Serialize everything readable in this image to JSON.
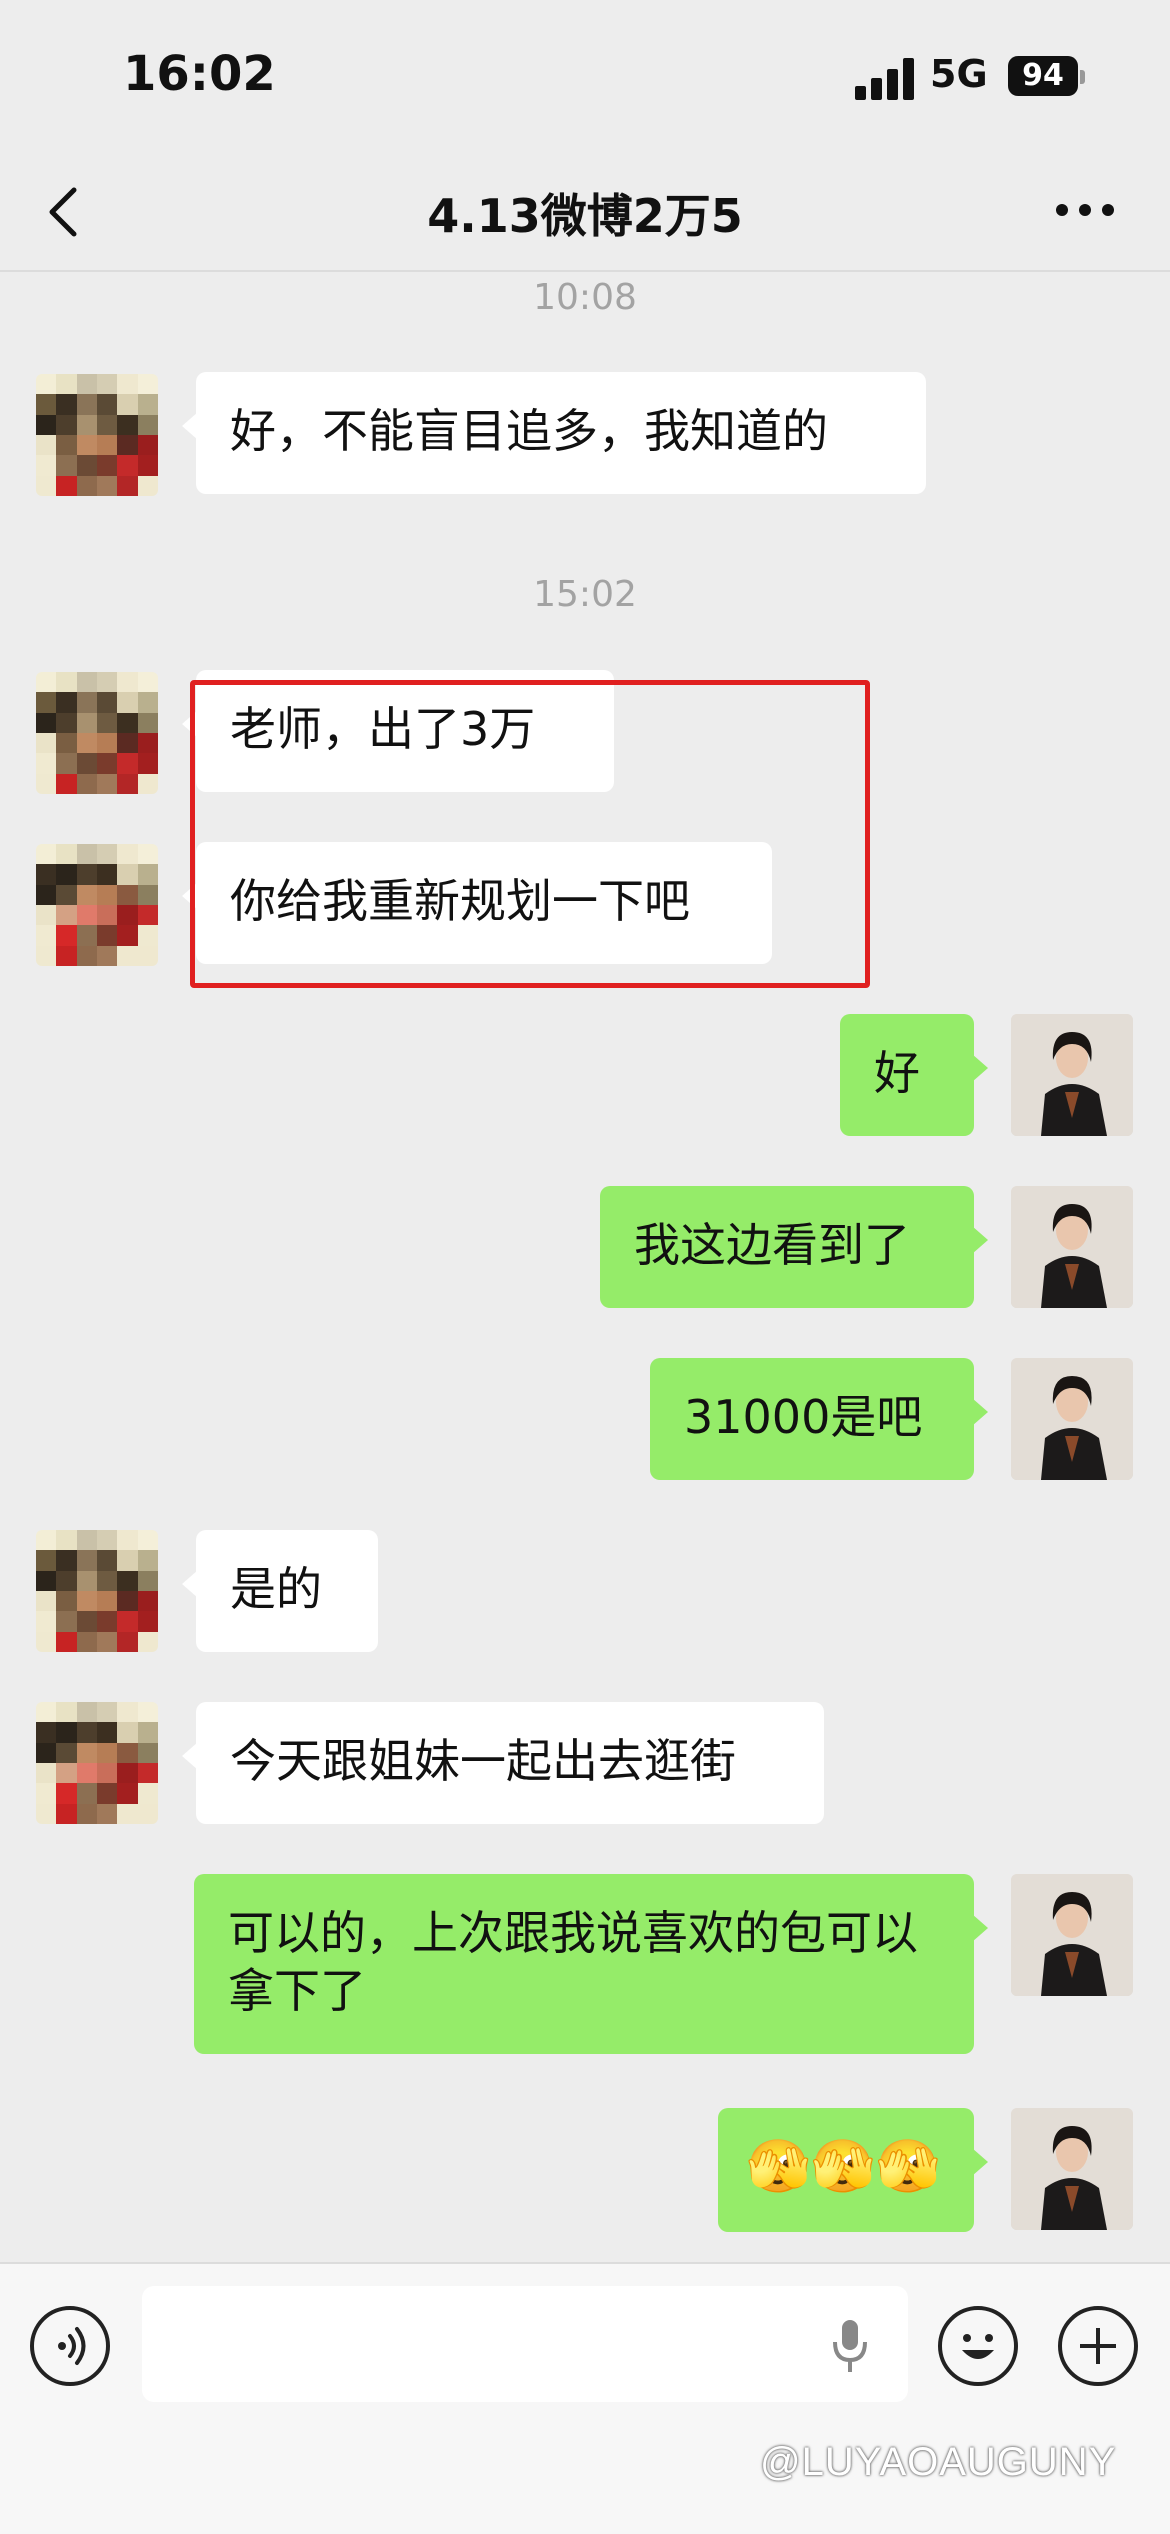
{
  "status_bar": {
    "time": "16:02",
    "network": "5G",
    "battery": "94"
  },
  "nav": {
    "title": "4.13微博2万5"
  },
  "timestamps": {
    "t1": "10:08",
    "t2": "15:02"
  },
  "messages": [
    {
      "side": "in",
      "text": "好，不能盲目追多，我知道的"
    },
    {
      "side": "in",
      "text": "老师，出了3万"
    },
    {
      "side": "in",
      "text": "你给我重新规划一下吧"
    },
    {
      "side": "out",
      "text": "好"
    },
    {
      "side": "out",
      "text": "我这边看到了"
    },
    {
      "side": "out",
      "text": "31000是吧"
    },
    {
      "side": "in",
      "text": "是的"
    },
    {
      "side": "in",
      "text": "今天跟姐妹一起出去逛街"
    },
    {
      "side": "out",
      "text": "可以的，上次跟我说喜欢的包可以拿下了"
    },
    {
      "side": "out",
      "text": "🫣🫣🫣"
    }
  ],
  "watermark": "@LUYAOAUGUNY",
  "colors": {
    "outgoing_bubble": "#95ec69",
    "incoming_bubble": "#ffffff",
    "background": "#ededed",
    "highlight": "#e02020"
  },
  "icons": [
    "back-arrow-icon",
    "more-icon",
    "voice-icon",
    "mic-icon",
    "emoji-icon",
    "plus-icon"
  ]
}
